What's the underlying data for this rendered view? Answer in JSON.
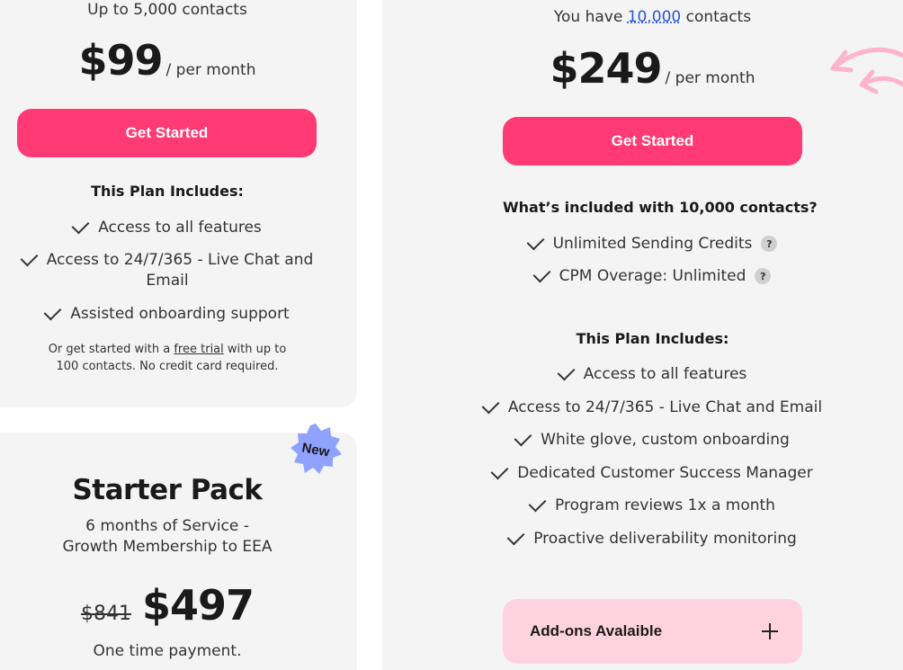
{
  "plan_left": {
    "contacts_text": "Up to 5,000 contacts",
    "price": "$99",
    "per": "/ per month",
    "cta_label": "Get Started",
    "includes_heading": "This Plan Includes:",
    "features": [
      "Access to all features",
      "Access to 24/7/365 - Live Chat and",
      "Email",
      "Assisted onboarding support"
    ],
    "note_prefix": "Or get started with a",
    "note_link": "free trial",
    "note_suffix": "with up to",
    "note_line2": "100 contacts. No credit card required."
  },
  "starter_pack": {
    "badge": "New",
    "title": "Starter Pack",
    "desc_line1": "6 months of Service -",
    "desc_line2": "Growth Membership to EEA",
    "old_price": "$841",
    "price": "$497",
    "payment_note": "One time payment."
  },
  "plan_right": {
    "contacts_prefix": "You have",
    "contacts_value": "10,000",
    "contacts_suffix": "contacts",
    "price": "$249",
    "per": "/ per month",
    "cta_label": "Get Started",
    "included_heading": "What’s included with 10,000 contacts?",
    "included_items": [
      "Unlimited Sending Credits",
      "CPM Overage: Unlimited"
    ],
    "help_glyph": "?",
    "includes_heading": "This Plan Includes:",
    "features": [
      "Access to all features",
      "Access to 24/7/365 - Live Chat and Email",
      "White glove, custom onboarding",
      "Dedicated Customer Success Manager",
      "Program reviews 1x a month",
      "Proactive deliverability monitoring"
    ],
    "addons_label": "Add-ons Avalaible"
  },
  "colors": {
    "accent": "#ff3a74",
    "addon_bg": "#ffd2df",
    "badge": "#8fa2ff",
    "arrow": "#ffb3cc",
    "card_bg": "#f4f4f4"
  },
  "icons": [
    "check-icon",
    "help-icon",
    "plus-icon",
    "new-badge-icon",
    "arrow-icon"
  ]
}
